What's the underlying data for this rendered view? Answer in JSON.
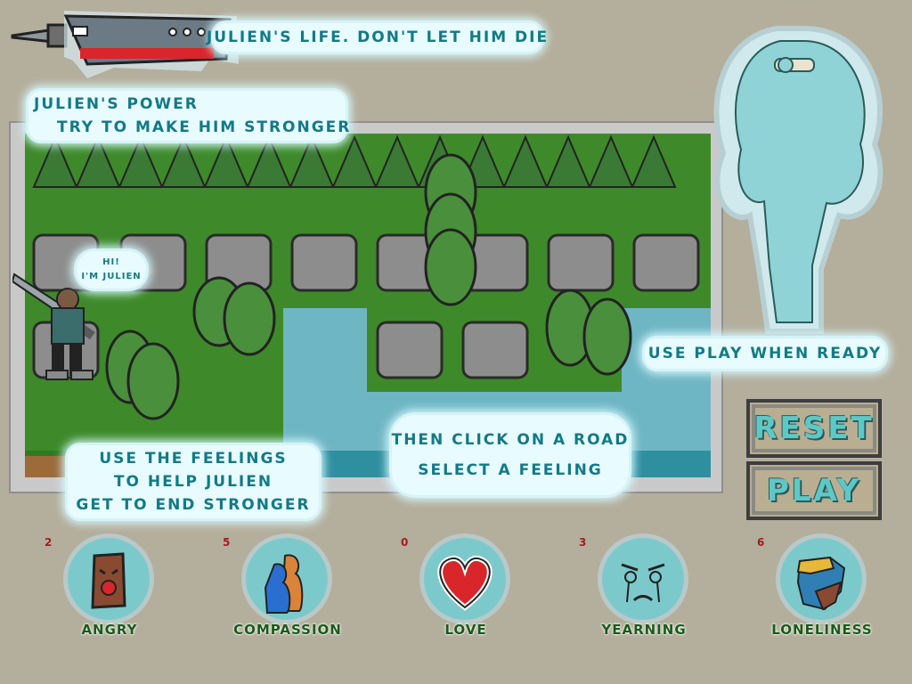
{
  "tutorial": {
    "life": "Julien's life. Don't let him die",
    "power_line1": "Julien's power",
    "power_line2": "Try to make him stronger",
    "greeting_line1": "Hi!",
    "greeting_line2": "I'm Julien",
    "feelings_line1": "Use the feelings",
    "feelings_line2": "to help Julien",
    "feelings_line3": "get to end stronger",
    "road_line1": "Then click on a road",
    "road_line2": "Select a feeling",
    "play_hint": "Use play when ready"
  },
  "buttons": {
    "reset": "RESET",
    "play": "PLAY"
  },
  "feelings": [
    {
      "name": "ANGRY",
      "count": "2"
    },
    {
      "name": "COMPASSION",
      "count": "5"
    },
    {
      "name": "LOVE",
      "count": "0"
    },
    {
      "name": "YEARNING",
      "count": "3"
    },
    {
      "name": "LONELINESS",
      "count": "6"
    }
  ],
  "colors": {
    "background": "#b4ae9c",
    "grass": "#3e8a2a",
    "water": "#6fb6c4",
    "bubble_text": "#127a86",
    "life_bar": "#d8262a",
    "ghost": "#8fd3d6",
    "counter": "#a31d1d"
  },
  "icons": {
    "sword": "sword-icon",
    "ghost": "ghost-woman",
    "player": "julien-knight"
  }
}
